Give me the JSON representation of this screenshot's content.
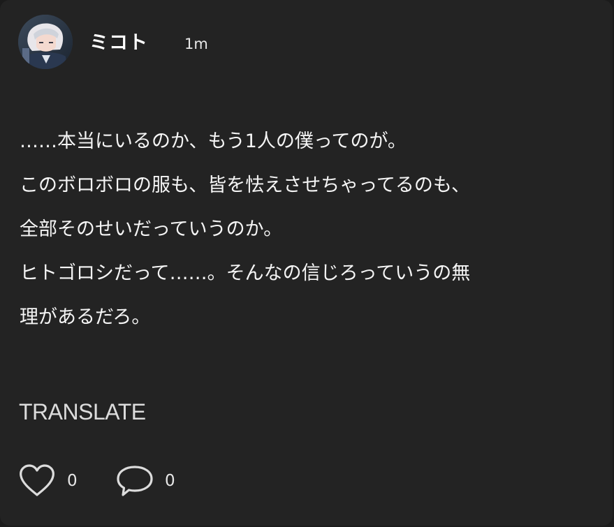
{
  "post": {
    "author": {
      "name": "ミコト",
      "avatar_icon": "avatar-icon"
    },
    "timestamp": "1m",
    "body_lines": [
      "……本当にいるのか、もう1人の僕ってのが。",
      "このボロボロの服も、皆を怯えさせちゃってるのも、",
      "全部そのせいだっていうのか。",
      "ヒトゴロシだって……。そんなの信じろっていうの無",
      "理があるだろ。"
    ],
    "translate_label": "TRANSLATE",
    "actions": {
      "like": {
        "icon": "heart-icon",
        "count": "0"
      },
      "comment": {
        "icon": "comment-bubble-icon",
        "count": "0"
      }
    }
  },
  "colors": {
    "card_background": "#232323",
    "text_primary": "#f5f5f5",
    "text_secondary": "#dcdcdc"
  }
}
